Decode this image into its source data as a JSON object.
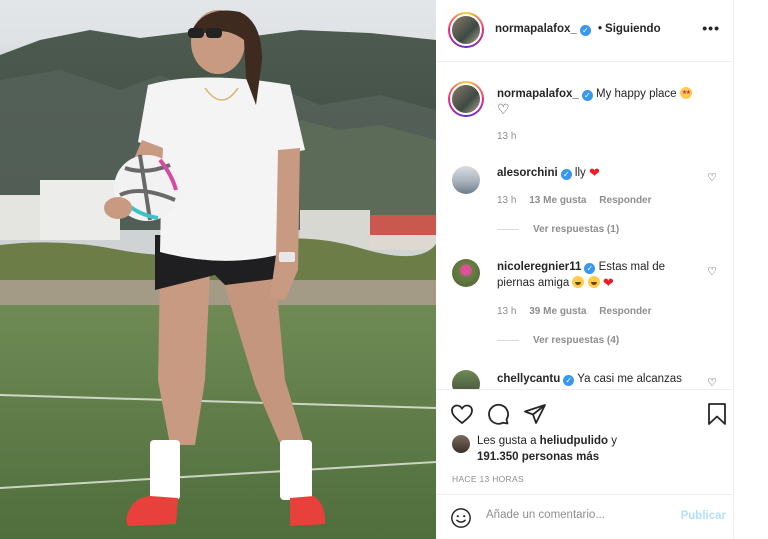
{
  "post": {
    "author": "normapalafox_",
    "follow_status": "Siguiendo",
    "more_icon": "more-horizontal-icon",
    "caption_text": "My happy place",
    "caption_time": "13 h"
  },
  "comments": [
    {
      "user": "alesorchini",
      "verified": true,
      "text": "lly",
      "time": "13 h",
      "likes": "13 Me gusta",
      "reply": "Responder",
      "replies": "Ver respuestas (1)"
    },
    {
      "user": "nicoleregnier11",
      "verified": true,
      "text": "Estas mal de piernas amiga",
      "time": "13 h",
      "likes": "39 Me gusta",
      "reply": "Responder",
      "replies": "Ver respuestas (4)"
    },
    {
      "user": "chellycantu",
      "verified": true,
      "text": "Ya casi me alcanzas"
    }
  ],
  "likes": {
    "prefix": "Les gusta a",
    "user": "heliudpulido",
    "connector": "y",
    "count": "191.350 personas más"
  },
  "time_ago": "HACE 13 HORAS",
  "comment_box": {
    "placeholder": "Añade un comentario...",
    "publish": "Publicar"
  },
  "colors": {
    "verified": "#3897f0",
    "publish_disabled": "#b2dffc",
    "heart_red": "#ed1c24",
    "secondary_text": "#8e8e8e"
  }
}
